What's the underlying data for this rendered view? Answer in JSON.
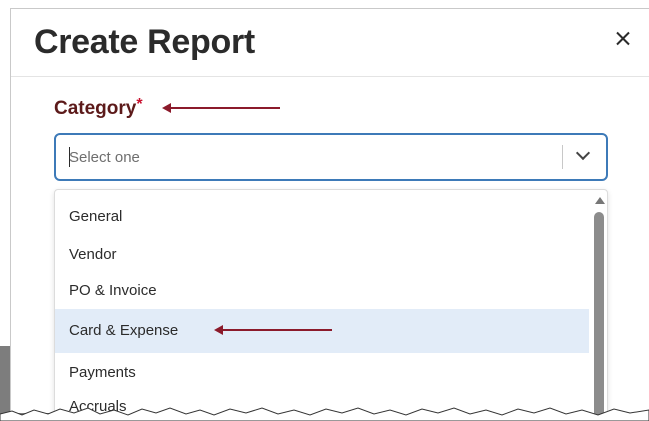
{
  "dialog": {
    "title": "Create Report",
    "close_icon": "close-icon"
  },
  "field": {
    "label": "Category",
    "required_mark": "*",
    "placeholder": "Select one",
    "dropdown_icon": "chevron-down-icon"
  },
  "dropdown": {
    "options": [
      "General",
      "Vendor",
      "PO & Invoice",
      "Card & Expense",
      "Payments",
      "Accruals"
    ],
    "highlighted": "Card & Expense"
  },
  "colors": {
    "focus_border": "#3d7ab8",
    "highlight": "#e2ecf8",
    "annotation_arrow": "#8b1a2b",
    "label": "#5c1a1a"
  }
}
